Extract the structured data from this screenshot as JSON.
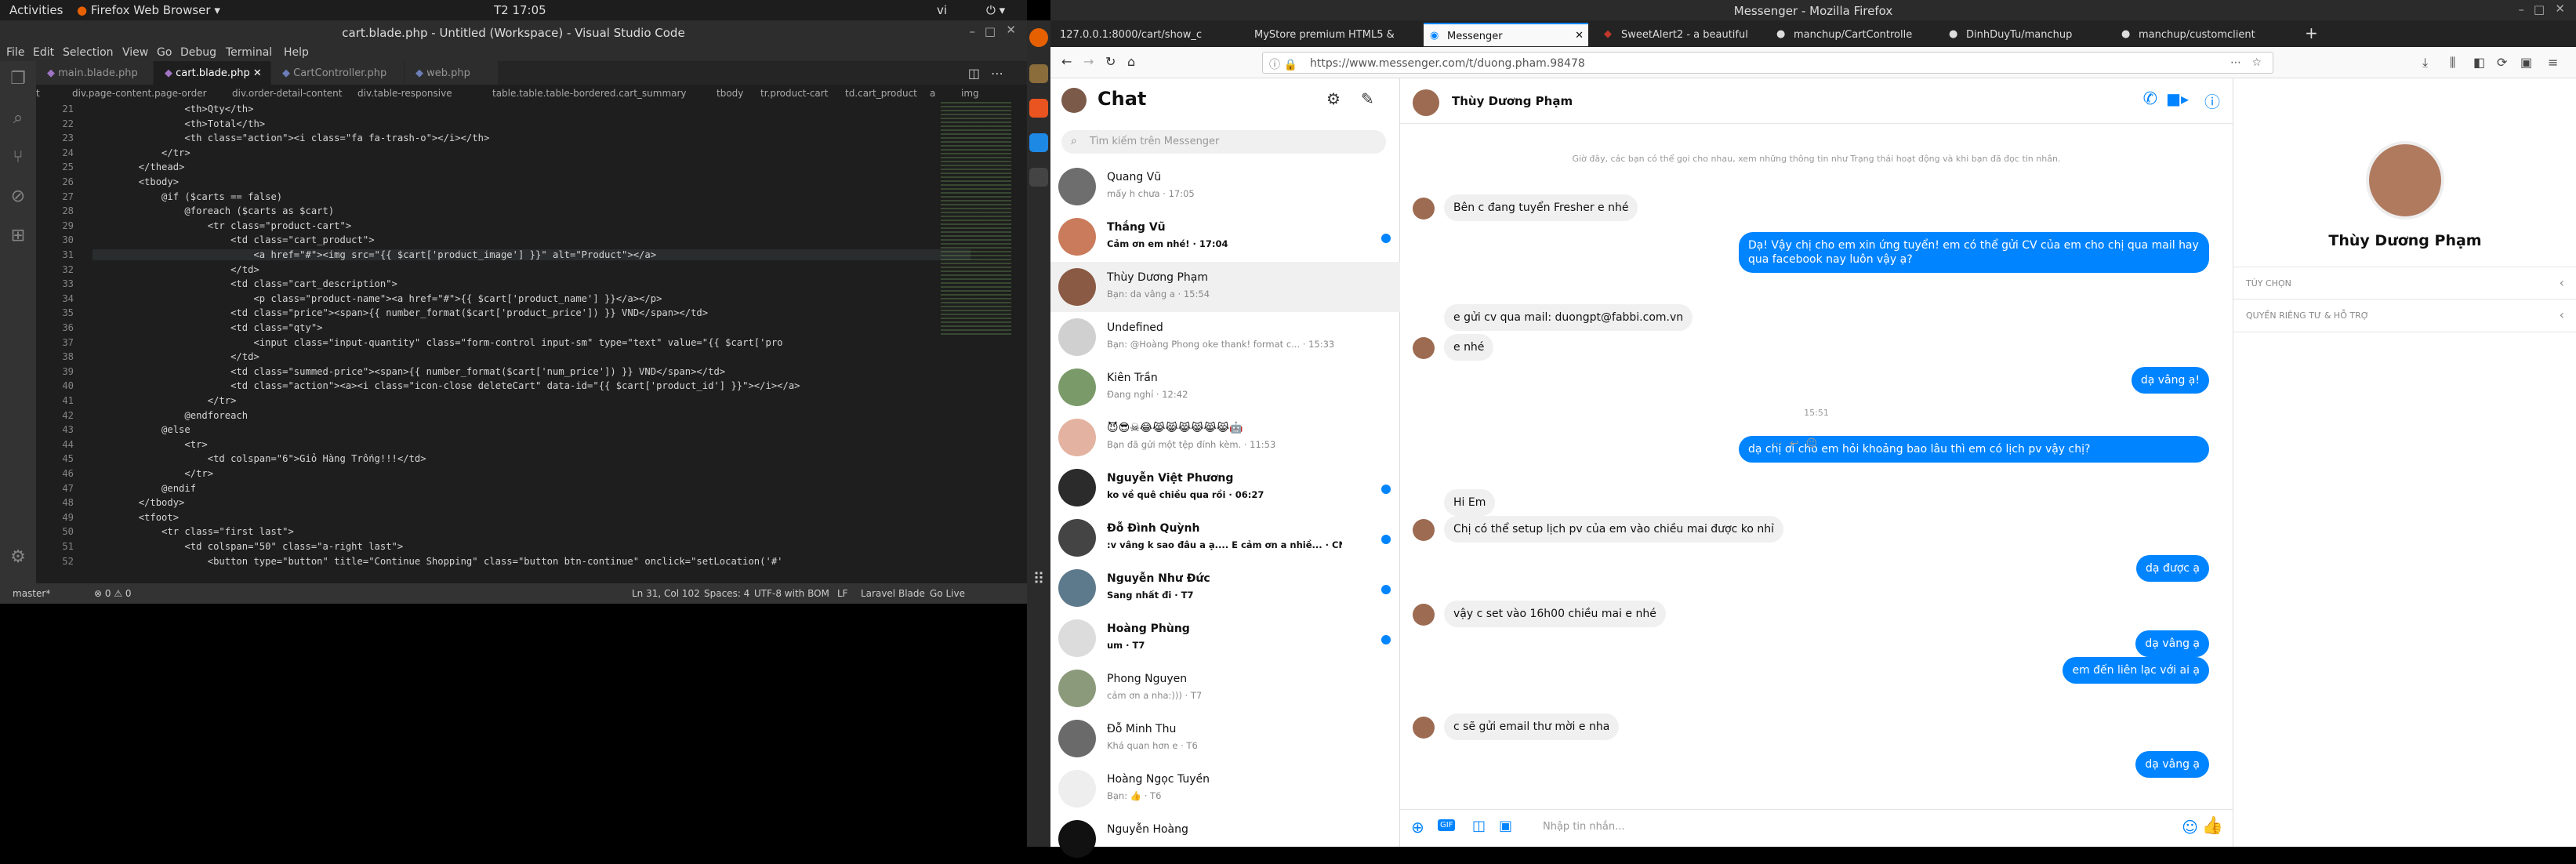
{
  "topbar": {
    "activities": "Activities",
    "app": "Firefox Web Browser",
    "clock": "T2 17:05",
    "lang": "vi"
  },
  "vscode": {
    "title": "cart.blade.php - Untitled (Workspace) - Visual Studio Code",
    "menu": [
      "File",
      "Edit",
      "Selection",
      "View",
      "Go",
      "Debug",
      "Terminal",
      "Help"
    ],
    "tabs": [
      "main.blade.php",
      "cart.blade.php",
      "CartController.php",
      "web.php"
    ],
    "breadcrumb": [
      "t",
      "div.page-content.page-order",
      "div.order-detail-content",
      "div.table-responsive",
      "table.table.table-bordered.cart_summary",
      "tbody",
      "tr.product-cart",
      "td.cart_product",
      "a",
      "img"
    ],
    "lines": [
      {
        "n": "21",
        "t": "                <th>Qty</th>"
      },
      {
        "n": "22",
        "t": "                <th>Total</th>"
      },
      {
        "n": "23",
        "t": "                <th class=\"action\"><i class=\"fa fa-trash-o\"></i></th>"
      },
      {
        "n": "24",
        "t": "            </tr>"
      },
      {
        "n": "25",
        "t": "        </thead>"
      },
      {
        "n": "26",
        "t": "        <tbody>"
      },
      {
        "n": "27",
        "t": "            @if ($carts == false)"
      },
      {
        "n": "28",
        "t": "                @foreach ($carts as $cart)"
      },
      {
        "n": "29",
        "t": "                    <tr class=\"product-cart\">"
      },
      {
        "n": "30",
        "t": "                        <td class=\"cart_product\">"
      },
      {
        "n": "31",
        "t": "                            <a href=\"#\"><img src=\"{{ $cart['product_image'] }}\" alt=\"Product\"></a>"
      },
      {
        "n": "32",
        "t": "                        </td>"
      },
      {
        "n": "33",
        "t": "                        <td class=\"cart_description\">"
      },
      {
        "n": "34",
        "t": "                            <p class=\"product-name\"><a href=\"#\">{{ $cart['product_name'] }}</a></p>"
      },
      {
        "n": "35",
        "t": "                        <td class=\"price\"><span>{{ number_format($cart['product_price']) }} VND</span></td>"
      },
      {
        "n": "36",
        "t": "                        <td class=\"qty\">"
      },
      {
        "n": "37",
        "t": "                            <input class=\"input-quantity\" class=\"form-control input-sm\" type=\"text\" value=\"{{ $cart['pro"
      },
      {
        "n": "38",
        "t": "                        </td>"
      },
      {
        "n": "39",
        "t": "                        <td class=\"summed-price\"><span>{{ number_format($cart['num_price']) }} VND</span></td>"
      },
      {
        "n": "40",
        "t": "                        <td class=\"action\"><a><i class=\"icon-close deleteCart\" data-id=\"{{ $cart['product_id'] }}\"></i></a>"
      },
      {
        "n": "41",
        "t": "                    </tr>"
      },
      {
        "n": "42",
        "t": "                @endforeach"
      },
      {
        "n": "43",
        "t": "            @else"
      },
      {
        "n": "44",
        "t": "                <tr>"
      },
      {
        "n": "45",
        "t": "                    <td colspan=\"6\">Giỏ Hàng Trống!!!</td>"
      },
      {
        "n": "46",
        "t": "                </tr>"
      },
      {
        "n": "47",
        "t": "            @endif"
      },
      {
        "n": "48",
        "t": "        </tbody>"
      },
      {
        "n": "49",
        "t": "        <tfoot>"
      },
      {
        "n": "50",
        "t": "            <tr class=\"first last\">"
      },
      {
        "n": "51",
        "t": "                <td colspan=\"50\" class=\"a-right last\">"
      },
      {
        "n": "52",
        "t": "                    <button type=\"button\" title=\"Continue Shopping\" class=\"button btn-continue\" onclick=\"setLocation('#'"
      }
    ],
    "status": {
      "branch": "master*",
      "errors": "⊗ 0 ⚠ 0",
      "pos": "Ln 31, Col 102",
      "spaces": "Spaces: 4",
      "enc": "UTF-8 with BOM",
      "eol": "LF",
      "lang": "Laravel Blade",
      "live": "Go Live"
    }
  },
  "firefox": {
    "title": "Messenger - Mozilla Firefox",
    "tabs": [
      "127.0.0.1:8000/cart/show_c",
      "MyStore premium HTML5 &",
      "Messenger",
      "SweetAlert2 - a beautiful",
      "manchup/CartControlle",
      "DinhDuyTu/manchup",
      "manchup/customclient"
    ],
    "url": "https://www.messenger.com/t/duong.pham.98478"
  },
  "messenger": {
    "chat_title": "Chat",
    "search_placeholder": "Tìm kiếm trên Messenger",
    "conversations": [
      {
        "name": "Quang Vũ",
        "preview": "mấy h chưa · 17:05",
        "unread": false
      },
      {
        "name": "Thắng Vũ",
        "preview": "Cảm ơn em nhé! · 17:04",
        "unread": true
      },
      {
        "name": "Thùy Dương Phạm",
        "preview": "Bạn: da vâng a · 15:54",
        "unread": false,
        "selected": true
      },
      {
        "name": "Undefined",
        "preview": "Bạn: @Hoàng Phong oke thank! format c... · 15:33",
        "unread": false
      },
      {
        "name": "Kiên Trần",
        "preview": "Đang nghỉ · 12:42",
        "unread": false
      },
      {
        "name": "😈😎☠😂😹😹😹😹😹😹🤖",
        "preview": "Bạn đã gửi một tệp đính kèm. · 11:53",
        "unread": false
      },
      {
        "name": "Nguyễn Việt Phương",
        "preview": "ko về quê chiều qua rồi · 06:27",
        "unread": true
      },
      {
        "name": "Đỗ Đình Quỳnh",
        "preview": ":v vâng k sao đâu a ạ.... E cảm ơn a nhiề... · CN",
        "unread": true
      },
      {
        "name": "Nguyễn Như Đức",
        "preview": "Sang nhất đi · T7",
        "unread": true
      },
      {
        "name": "Hoàng Phùng",
        "preview": "um · T7",
        "unread": true
      },
      {
        "name": "Phong Nguyen",
        "preview": "cảm ơn a nha:))) · T7",
        "unread": false
      },
      {
        "name": "Đỗ Minh Thu",
        "preview": "Khá quan hơn e · T6",
        "unread": false
      },
      {
        "name": "Hoàng Ngọc Tuyền",
        "preview": "Bạn: 👍 · T6",
        "unread": false
      },
      {
        "name": "Nguyễn Hoàng",
        "preview": "",
        "unread": false
      }
    ],
    "header_name": "Thùy Dương Phạm",
    "system_note": "Giờ đây, các bạn có thể gọi cho nhau, xem những thông tin như Trạng thái hoạt động và khi bạn đã đọc tin nhắn.",
    "time_sep": "15:51",
    "messages": [
      {
        "side": "in",
        "text": "Bên c đang tuyển Fresher e nhé"
      },
      {
        "side": "out",
        "text": "Dạ! Vậy chị cho em xin ứng tuyển! em có thể gửi CV của em cho chị qua mail hay qua facebook nay luôn vậy ạ?"
      },
      {
        "side": "in",
        "text": "e gửi cv qua mail: duongpt@fabbi.com.vn"
      },
      {
        "side": "in",
        "text": "e nhé"
      },
      {
        "side": "out",
        "text": "dạ vâng ạ!"
      },
      {
        "side": "out",
        "text": "dạ chị ơi cho em hỏi khoảng bao lâu thì em có lịch pv vậy chị?"
      },
      {
        "side": "in",
        "text": "Hi Em"
      },
      {
        "side": "in",
        "text": "Chị có thể setup lịch pv của em vào chiều mai được ko nhỉ"
      },
      {
        "side": "out",
        "text": "dạ được ạ"
      },
      {
        "side": "in",
        "text": "vậy c set vào 16h00 chiều mai e nhé"
      },
      {
        "side": "out",
        "text": "dạ vâng ạ"
      },
      {
        "side": "out",
        "text": "em đến liên lạc với ai ạ"
      },
      {
        "side": "in",
        "text": "c sẽ gửi email thư mời e nha"
      },
      {
        "side": "out",
        "text": "dạ vâng ạ"
      }
    ],
    "input_placeholder": "Nhập tin nhắn...",
    "profile_name": "Thùy Dương Phạm",
    "options": [
      "TÙY CHỌN",
      "QUYỀN RIÊNG TƯ & HỖ TRỢ"
    ]
  }
}
